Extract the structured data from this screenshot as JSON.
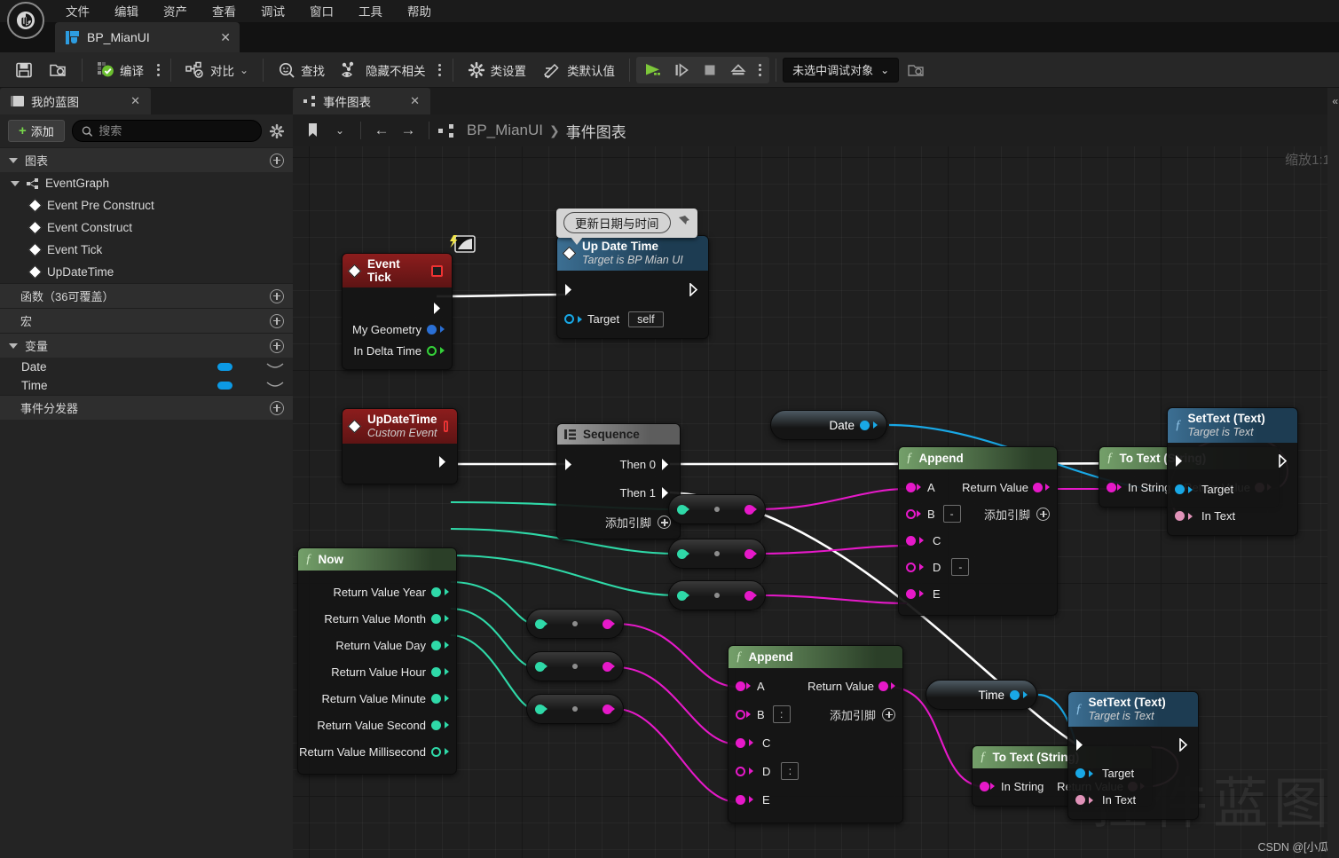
{
  "app": {
    "logo": "ue-logo",
    "menu": [
      "文件",
      "编辑",
      "资产",
      "查看",
      "调试",
      "窗口",
      "工具",
      "帮助"
    ]
  },
  "asset_tab": {
    "label": "BP_MianUI",
    "close": "✕",
    "icon": "blueprint-icon"
  },
  "toolbar": {
    "save_label": "",
    "browse_label": "",
    "compile_label": "编译",
    "diff_label": "对比",
    "find_label": "查找",
    "hide_unrelated_label": "隐藏不相关",
    "class_settings_label": "类设置",
    "class_defaults_label": "类默认值",
    "debug_object_label": "未选中调试对象",
    "chevron": "⌄"
  },
  "left_panel": {
    "tab_label": "我的蓝图",
    "tab_close": "✕",
    "add_label": "添加",
    "search_placeholder": "搜索",
    "search_value": "",
    "sections": [
      {
        "label": "图表",
        "expandable": true
      },
      {
        "label": "函数（36可覆盖）",
        "expandable": false
      },
      {
        "label": "宏",
        "expandable": false
      },
      {
        "label": "变量",
        "expandable": true
      },
      {
        "label": "事件分发器",
        "expandable": false
      }
    ],
    "graph_root": "EventGraph",
    "events": [
      "Event Pre Construct",
      "Event Construct",
      "Event Tick",
      "UpDateTime"
    ],
    "variables": [
      {
        "name": "Date",
        "color": "#0c9ae5"
      },
      {
        "name": "Time",
        "color": "#0c9ae5"
      }
    ]
  },
  "graph": {
    "tab_label": "事件图表",
    "tab_close": "✕",
    "breadcrumb_root": "BP_MianUI",
    "breadcrumb_arrow": "❯",
    "breadcrumb_current": "事件图表",
    "back_icon": "←",
    "forward_icon": "→",
    "zoom_label": "缩放1:1",
    "watermark": "控件蓝图",
    "watermark_credit": "CSDN @[小瓜]"
  },
  "comment": {
    "text": "更新日期与时间"
  },
  "nodes": {
    "event_tick": {
      "title": "Event Tick",
      "pins": [
        "My Geometry",
        "In Delta Time"
      ]
    },
    "updatetime_call": {
      "title": "Up Date Time",
      "subtitle": "Target is BP Mian UI",
      "target_label": "Target",
      "target_value": "self"
    },
    "updatetime_event": {
      "title": "UpDateTime",
      "subtitle": "Custom Event"
    },
    "sequence": {
      "title": "Sequence",
      "then0": "Then 0",
      "then1": "Then 1",
      "addpin": "添加引脚"
    },
    "now": {
      "title": "Now",
      "outputs": [
        "Return Value Year",
        "Return Value Month",
        "Return Value Day",
        "Return Value Hour",
        "Return Value Minute",
        "Return Value Second",
        "Return Value Millisecond"
      ]
    },
    "append_date": {
      "title": "Append",
      "return_label": "Return Value",
      "addpin": "添加引脚",
      "inputs": [
        {
          "name": "A",
          "sep": ""
        },
        {
          "name": "B",
          "sep": "-"
        },
        {
          "name": "C",
          "sep": ""
        },
        {
          "name": "D",
          "sep": "-"
        },
        {
          "name": "E",
          "sep": ""
        }
      ]
    },
    "append_time": {
      "title": "Append",
      "return_label": "Return Value",
      "addpin": "添加引脚",
      "inputs": [
        {
          "name": "A",
          "sep": ""
        },
        {
          "name": "B",
          "sep": ":"
        },
        {
          "name": "C",
          "sep": ""
        },
        {
          "name": "D",
          "sep": ":"
        },
        {
          "name": "E",
          "sep": ""
        }
      ]
    },
    "to_text_date": {
      "title": "To Text (String)",
      "in_label": "In String",
      "out_label": "Return Value"
    },
    "to_text_time": {
      "title": "To Text (String)",
      "in_label": "In String",
      "out_label": "Return Value"
    },
    "settext_date": {
      "title": "SetText (Text)",
      "subtitle": "Target is Text",
      "target_label": "Target",
      "intext_label": "In Text"
    },
    "settext_time": {
      "title": "SetText (Text)",
      "subtitle": "Target is Text",
      "target_label": "Target",
      "intext_label": "In Text"
    },
    "var_date": {
      "label": "Date"
    },
    "var_time": {
      "label": "Time"
    }
  },
  "colors": {
    "exec_white": "#ffffff",
    "int_green": "#2fd9a8",
    "string_magenta": "#e619c9",
    "text_pink": "#e092b8",
    "object_blue": "#19a8e6",
    "float_green": "#35d13a"
  }
}
